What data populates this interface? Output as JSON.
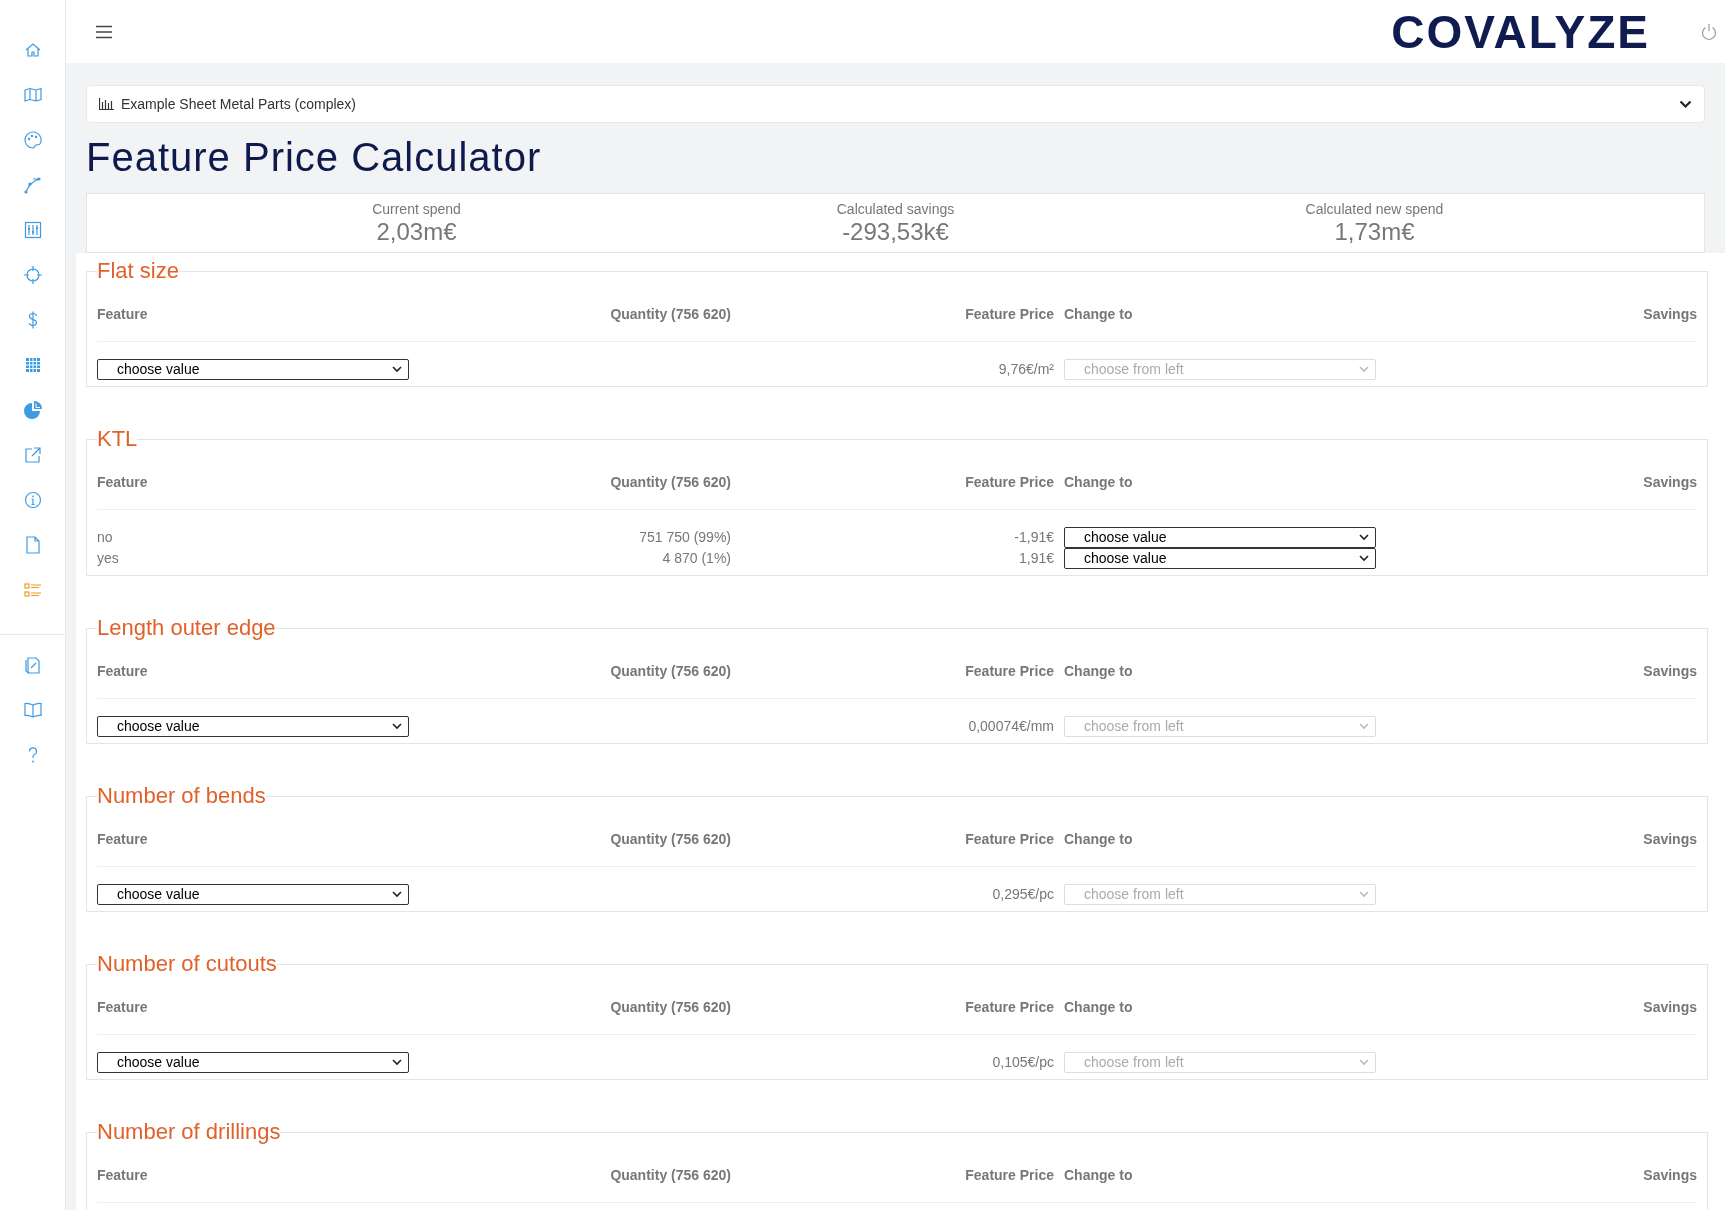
{
  "sidebar": {
    "top_items": [
      {
        "selected": false
      },
      {
        "selected": false
      },
      {
        "selected": false
      },
      {
        "selected": false
      },
      {
        "selected": false
      },
      {
        "selected": false
      },
      {
        "selected": false
      },
      {
        "selected": false
      },
      {
        "selected": false
      },
      {
        "selected": false
      },
      {
        "selected": false
      },
      {
        "selected": false
      },
      {
        "selected": true
      }
    ],
    "bottom_items": [
      {
        "selected": false
      },
      {
        "selected": false
      },
      {
        "selected": false
      }
    ]
  },
  "header": {
    "logo": "COVALYZE"
  },
  "dataset_selector": {
    "value": "Example Sheet Metal Parts (complex)"
  },
  "title": "Feature Price Calculator",
  "stats": [
    {
      "label": "Current spend",
      "value": "2,03m€"
    },
    {
      "label": "Calculated savings",
      "value": "-293,53k€"
    },
    {
      "label": "Calculated new spend",
      "value": "1,73m€"
    }
  ],
  "sections": [
    {
      "title": "Flat size",
      "kind": "select",
      "columns": [
        "Feature",
        "Quantity (756 620)",
        "Feature Price",
        "Change to",
        "Savings"
      ],
      "feature": "choose value",
      "price": "9,76€/m²",
      "change_to": {
        "value": "choose from left",
        "disabled": true
      }
    },
    {
      "title": "KTL",
      "kind": "values",
      "columns": [
        "Feature",
        "Quantity (756 620)",
        "Feature Price",
        "Change to",
        "Savings"
      ],
      "rows": [
        {
          "feature": "no",
          "quantity": "751 750 (99%)",
          "price": "-1,91€",
          "change_to": {
            "value": "choose value",
            "disabled": false
          }
        },
        {
          "feature": "yes",
          "quantity": "4 870 (1%)",
          "price": "1,91€",
          "change_to": {
            "value": "choose value",
            "disabled": false
          }
        }
      ]
    },
    {
      "title": "Length outer edge",
      "kind": "select",
      "columns": [
        "Feature",
        "Quantity (756 620)",
        "Feature Price",
        "Change to",
        "Savings"
      ],
      "feature": "choose value",
      "price": "0,00074€/mm",
      "change_to": {
        "value": "choose from left",
        "disabled": true
      }
    },
    {
      "title": "Number of bends",
      "kind": "select",
      "columns": [
        "Feature",
        "Quantity (756 620)",
        "Feature Price",
        "Change to",
        "Savings"
      ],
      "feature": "choose value",
      "price": "0,295€/pc",
      "change_to": {
        "value": "choose from left",
        "disabled": true
      }
    },
    {
      "title": "Number of cutouts",
      "kind": "select",
      "columns": [
        "Feature",
        "Quantity (756 620)",
        "Feature Price",
        "Change to",
        "Savings"
      ],
      "feature": "choose value",
      "price": "0,105€/pc",
      "change_to": {
        "value": "choose from left",
        "disabled": true
      }
    },
    {
      "title": "Number of drillings",
      "kind": "select",
      "columns": [
        "Feature",
        "Quantity (756 620)",
        "Feature Price",
        "Change to",
        "Savings"
      ]
    }
  ]
}
